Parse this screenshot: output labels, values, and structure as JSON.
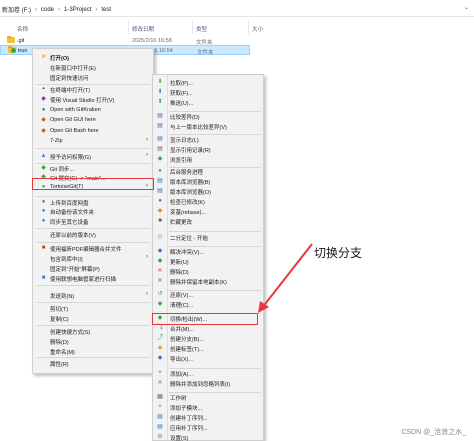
{
  "address": {
    "crumbs": [
      "新加卷 (F:)",
      "code",
      "1-3Project",
      "test"
    ]
  },
  "columns": {
    "name": "名称",
    "date": "修改日期",
    "type": "类型",
    "size": "大小"
  },
  "files": [
    {
      "name": ".git",
      "date": "2025/2/16 16:58",
      "type": "文件夹"
    },
    {
      "name": "trun",
      "date": "2025/2/16 16:54",
      "type": "文件夹"
    }
  ],
  "context_menu": {
    "items": [
      {
        "label": "打开(O)",
        "icon": "folder-icon",
        "bold": true
      },
      {
        "label": "在新窗口中打开(E)",
        "icon": ""
      },
      {
        "label": "固定到快速访问",
        "icon": ""
      },
      {
        "label": "在终端中打开(T)",
        "icon": "terminal-icon"
      },
      {
        "label": "使用 Visual Studio 打开(V)",
        "icon": "visual-studio-icon"
      },
      {
        "label": "Open with GitKraken",
        "icon": "gitkraken-icon"
      },
      {
        "label": "Open Git GUI here",
        "icon": "git-gui-icon"
      },
      {
        "label": "Open Git Bash here",
        "icon": "git-bash-icon"
      },
      {
        "label": "7-Zip",
        "icon": "",
        "submenu": true
      },
      {
        "label": "授予访问权限(G)",
        "icon": "share-icon",
        "submenu": true
      },
      {
        "label": "Git 同步...",
        "icon": "git-sync-icon"
      },
      {
        "label": "Git 提交(C) -> \"main\"...",
        "icon": "git-commit-icon"
      },
      {
        "label": "TortoiseGit(T)",
        "icon": "tortoisegit-icon",
        "submenu": true
      },
      {
        "label": "上传到百度网盘",
        "icon": "baidu-upload-icon"
      },
      {
        "label": "自动备份该文件夹",
        "icon": "baidu-backup-icon"
      },
      {
        "label": "同步至其它设备",
        "icon": "baidu-sync-icon"
      },
      {
        "label": "还原以前的版本(V)",
        "icon": ""
      },
      {
        "label": "使用福昕PDF编辑器合并文件",
        "icon": "foxit-icon"
      },
      {
        "label": "包含到库中(I)",
        "icon": "",
        "submenu": true
      },
      {
        "label": "固定到\"开始\"屏幕(P)",
        "icon": ""
      },
      {
        "label": "使用联想电脑管家进行扫描",
        "icon": "lenovo-icon"
      },
      {
        "label": "发送到(N)",
        "icon": "",
        "submenu": true
      },
      {
        "label": "剪切(T)",
        "icon": ""
      },
      {
        "label": "复制(C)",
        "icon": ""
      },
      {
        "label": "创建快捷方式(S)",
        "icon": ""
      },
      {
        "label": "删除(D)",
        "icon": ""
      },
      {
        "label": "重命名(M)",
        "icon": ""
      },
      {
        "label": "属性(R)",
        "icon": ""
      }
    ]
  },
  "tortoisegit_menu": {
    "items": [
      {
        "label": "拉取(P)...",
        "icon": "pull-icon"
      },
      {
        "label": "获取(F)...",
        "icon": "fetch-icon"
      },
      {
        "label": "推送(U)...",
        "icon": "push-icon"
      },
      {
        "label": "比较差异(D)",
        "icon": "diff-icon"
      },
      {
        "label": "与上一版本比较差异(V)",
        "icon": "diff-prev-icon"
      },
      {
        "label": "显示日志(L)",
        "icon": "log-icon"
      },
      {
        "label": "显示引用记录(R)",
        "icon": "reflog-icon"
      },
      {
        "label": "浏览引用",
        "icon": "browse-refs-icon"
      },
      {
        "label": "后台服务进程",
        "icon": "daemon-icon"
      },
      {
        "label": "版本库浏览器(B)",
        "icon": "repo-browser-icon"
      },
      {
        "label": "版本库浏览器(O)",
        "icon": "repo-browser-icon"
      },
      {
        "label": "检查已修改(K)",
        "icon": "check-mods-icon"
      },
      {
        "label": "变基(rebase)...",
        "icon": "rebase-icon"
      },
      {
        "label": "贮藏更改",
        "icon": "stash-icon"
      },
      {
        "label": "二分定位 - 开始",
        "icon": "bisect-icon"
      },
      {
        "label": "解决冲突(V)...",
        "icon": "resolve-icon"
      },
      {
        "label": "更新(U)",
        "icon": "update-icon"
      },
      {
        "label": "删除(D)",
        "icon": "delete-icon"
      },
      {
        "label": "删除并保留本地副本(K)",
        "icon": "delete-keep-icon"
      },
      {
        "label": "还原(V)...",
        "icon": "revert-icon"
      },
      {
        "label": "清理(C)...",
        "icon": "cleanup-icon"
      },
      {
        "label": "切换/检出(W)...",
        "icon": "switch-checkout-icon"
      },
      {
        "label": "合并(M)...",
        "icon": "merge-icon"
      },
      {
        "label": "创建分支(B)...",
        "icon": "branch-icon"
      },
      {
        "label": "创建标签(T)...",
        "icon": "tag-icon"
      },
      {
        "label": "导出(X)...",
        "icon": "export-icon"
      },
      {
        "label": "添加(A)...",
        "icon": "add-icon"
      },
      {
        "label": "删除并添加到忽略列表(I)",
        "icon": "ignore-icon"
      },
      {
        "label": "工作树",
        "icon": "worktree-icon"
      },
      {
        "label": "添加子模块...",
        "icon": "submodule-icon"
      },
      {
        "label": "创建补丁序列...",
        "icon": "patch-icon"
      },
      {
        "label": "应用补丁序列...",
        "icon": "apply-patch-icon"
      },
      {
        "label": "设置(S)",
        "icon": "settings-icon"
      }
    ]
  },
  "annotation": {
    "callout": "切换分支",
    "color": "#e8383d"
  },
  "watermark": "CSDN @_沧浪之水_"
}
